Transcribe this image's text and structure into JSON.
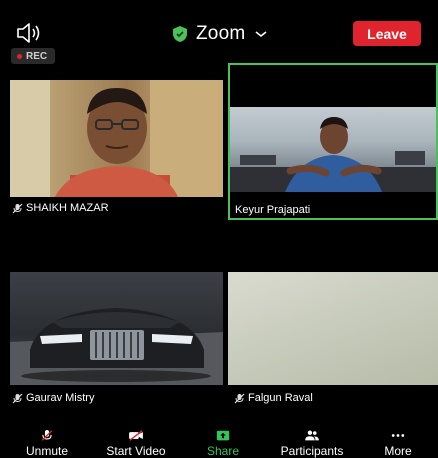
{
  "header": {
    "title": "Zoom",
    "leave_label": "Leave",
    "rec_label": "REC"
  },
  "participants": [
    {
      "name": "SHAIKH MAZAR",
      "muted": true,
      "active_speaker": false
    },
    {
      "name": "Keyur Prajapati",
      "muted": false,
      "active_speaker": true
    },
    {
      "name": "Gaurav Mistry",
      "muted": true,
      "active_speaker": false
    },
    {
      "name": "Falgun Raval",
      "muted": true,
      "active_speaker": false
    }
  ],
  "toolbar": {
    "unmute_label": "Unmute",
    "start_video_label": "Start Video",
    "share_label": "Share",
    "participants_label": "Participants",
    "more_label": "More"
  },
  "colors": {
    "leave": "#e0242e",
    "active_border": "#4ac15a",
    "share_green": "#35c35a",
    "shield_green": "#4ac15a"
  }
}
